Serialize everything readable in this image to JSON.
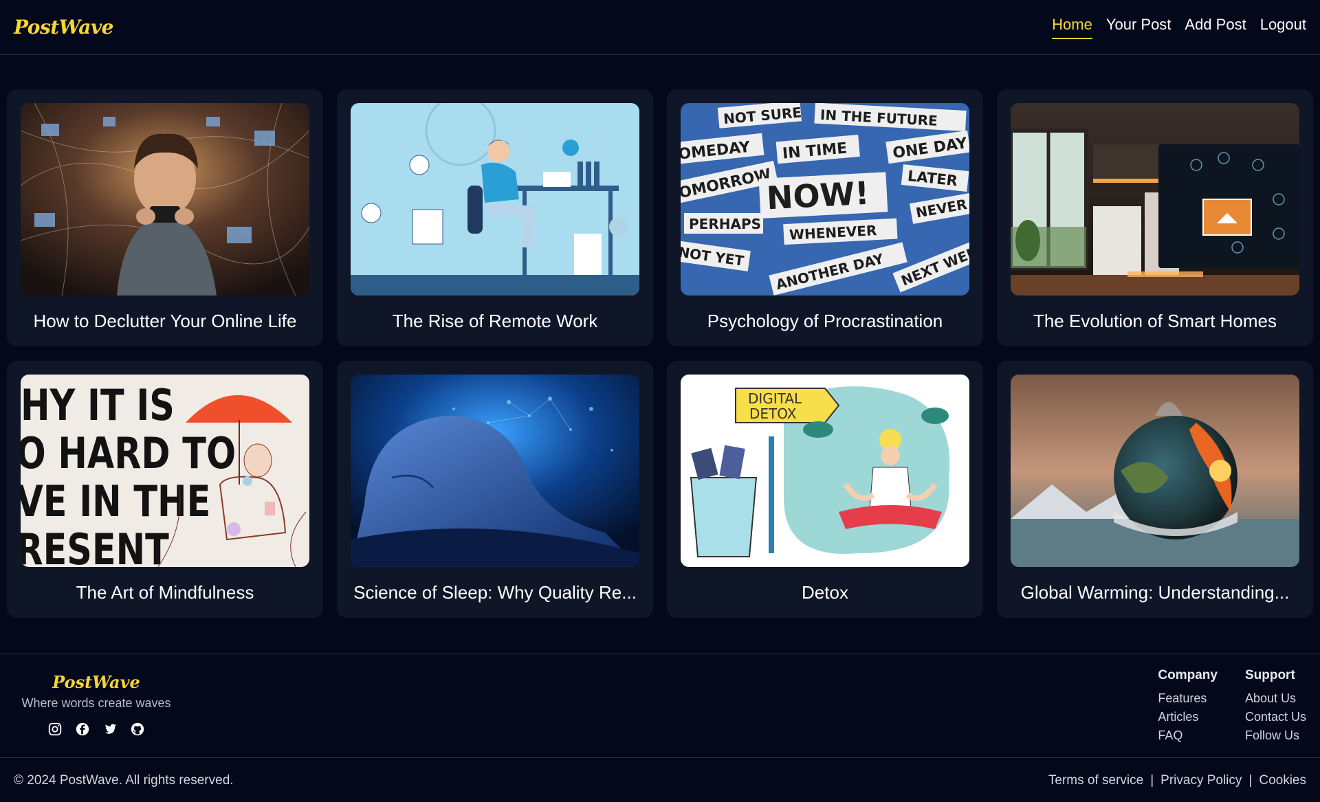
{
  "brand": {
    "name": "PostWave",
    "accent_color": "#f7d634",
    "background_color": "#03081a",
    "card_color": "#0e1628"
  },
  "nav": {
    "links": [
      {
        "label": "Home",
        "active": true
      },
      {
        "label": "Your Post",
        "active": false
      },
      {
        "label": "Add Post",
        "active": false
      },
      {
        "label": "Logout",
        "active": false
      }
    ]
  },
  "posts": [
    {
      "title": "How to Declutter Your Online Life",
      "image": "man-using-phone-amid-digital-chaos"
    },
    {
      "title": "The Rise of Remote Work",
      "image": "remote-work-illustration"
    },
    {
      "title": "Psychology of Procrastination",
      "image": "procrastination-word-clippings"
    },
    {
      "title": "The Evolution of Smart Homes",
      "image": "smart-home-kitchen"
    },
    {
      "title": "The Art of Mindfulness",
      "image": "why-it-is-so-hard-to-live-in-the-present"
    },
    {
      "title": "Science of Sleep: Why Quality Re...",
      "image": "sleeping-head-blue"
    },
    {
      "title": "Detox",
      "image": "digital-detox-meditation"
    },
    {
      "title": "Global Warming: Understanding...",
      "image": "burning-earth"
    }
  ],
  "poster_text": [
    "HY IT IS",
    "O HARD TO",
    "VE IN THE",
    "RESENT"
  ],
  "procrastination_words": [
    "NOT SURE",
    "IN THE FUTURE",
    "OMEDAY",
    "IN TIME",
    "ONE DAY",
    "OMORROW",
    "LATER",
    "NOW!",
    "PERHAPS",
    "NEVER",
    "WHENEVER",
    "NOT YET",
    "ANOTHER DAY",
    "NEXT WEE"
  ],
  "detox_sign": [
    "DIGITAL",
    "DETOX"
  ],
  "footer": {
    "brand": "PostWave",
    "tagline": "Where words create waves",
    "socials": [
      "instagram-icon",
      "facebook-icon",
      "twitter-icon",
      "github-icon"
    ],
    "columns": [
      {
        "heading": "Company",
        "links": [
          "Features",
          "Articles",
          "FAQ"
        ]
      },
      {
        "heading": "Support",
        "links": [
          "About Us",
          "Contact Us",
          "Follow Us"
        ]
      }
    ],
    "copyright": "© 2024 PostWave. All rights reserved.",
    "legal": [
      "Terms of service",
      "Privacy Policy",
      "Cookies"
    ],
    "separator": "|"
  }
}
